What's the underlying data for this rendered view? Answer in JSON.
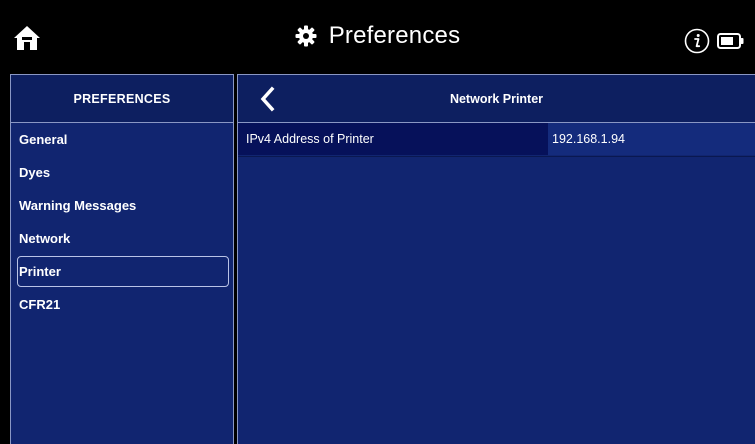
{
  "header": {
    "title": "Preferences",
    "home_icon": "home-icon",
    "settings_icon": "gear-icon",
    "info_icon": "info-icon",
    "battery_icon": "battery-icon"
  },
  "sidebar": {
    "title": "PREFERENCES",
    "items": [
      {
        "label": "General",
        "selected": false
      },
      {
        "label": "Dyes",
        "selected": false
      },
      {
        "label": "Warning Messages",
        "selected": false
      },
      {
        "label": "Network",
        "selected": false
      },
      {
        "label": "Printer",
        "selected": true
      },
      {
        "label": "CFR21",
        "selected": false
      }
    ]
  },
  "main": {
    "title": "Network Printer",
    "back_icon": "chevron-left-icon",
    "settings": [
      {
        "label": "IPv4 Address of Printer",
        "value": "192.168.1.94"
      }
    ]
  },
  "colors": {
    "background": "#000000",
    "panel": "#112570",
    "panel_header": "#0d1f60",
    "row_label": "#06115a",
    "row_value": "#142b7c",
    "border": "#8a97c4"
  }
}
